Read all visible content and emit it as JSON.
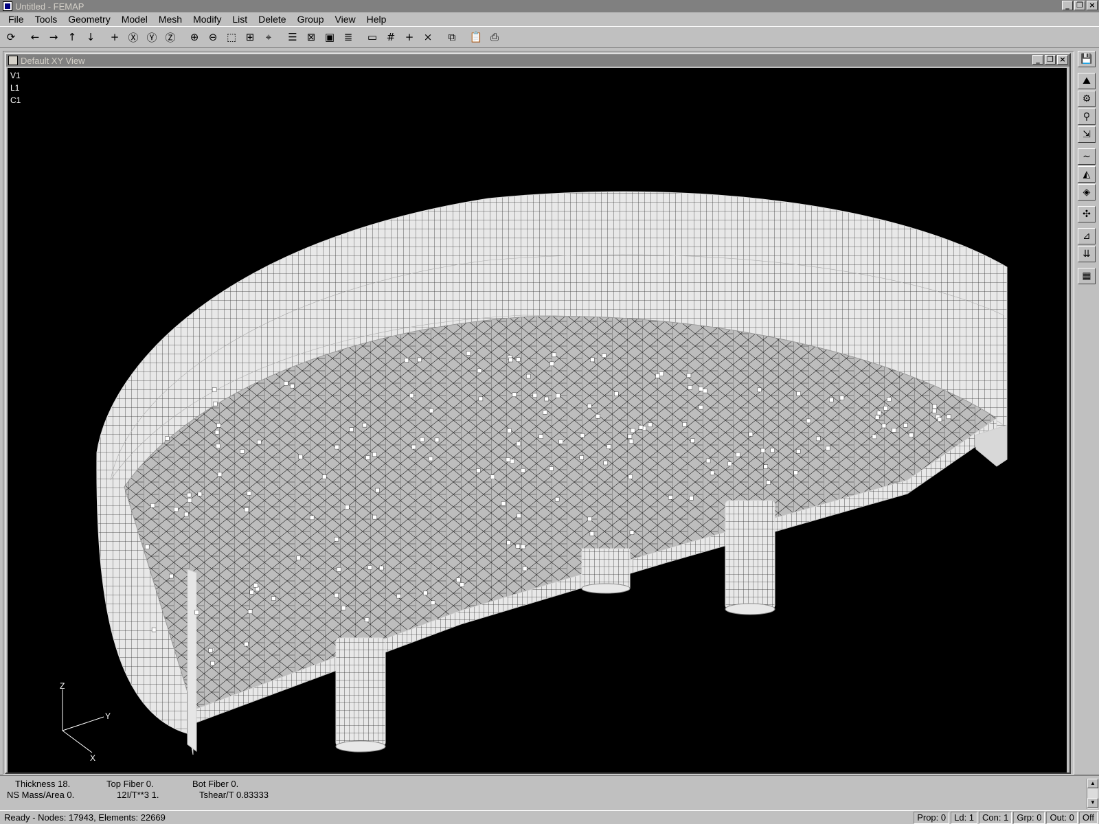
{
  "app": {
    "title": "Untitled - FEMAP",
    "icon": "femap-app-icon",
    "window_buttons": [
      "_",
      "❐",
      "×"
    ]
  },
  "menu": {
    "items": [
      {
        "label": "File",
        "underline": "F"
      },
      {
        "label": "Tools",
        "underline": "T"
      },
      {
        "label": "Geometry",
        "underline": "G"
      },
      {
        "label": "Model",
        "underline": "M"
      },
      {
        "label": "Mesh",
        "underline": "e"
      },
      {
        "label": "Modify",
        "underline": "o"
      },
      {
        "label": "List",
        "underline": "L"
      },
      {
        "label": "Delete",
        "underline": "D"
      },
      {
        "label": "Group",
        "underline": "G"
      },
      {
        "label": "View",
        "underline": "V"
      },
      {
        "label": "Help",
        "underline": "H"
      }
    ]
  },
  "toolbar": {
    "buttons": [
      {
        "name": "rotate-view-icon",
        "glyph": "⟳"
      },
      {
        "sep": true
      },
      {
        "name": "pan-left-icon",
        "glyph": "←"
      },
      {
        "name": "pan-right-icon",
        "glyph": "→"
      },
      {
        "name": "pan-up-icon",
        "glyph": "↑"
      },
      {
        "name": "pan-down-icon",
        "glyph": "↓"
      },
      {
        "sep": true
      },
      {
        "name": "center-icon",
        "glyph": "+"
      },
      {
        "name": "rotate-x-icon",
        "glyph": "Ⓧ"
      },
      {
        "name": "rotate-y-icon",
        "glyph": "Ⓨ"
      },
      {
        "name": "rotate-z-icon",
        "glyph": "Ⓩ"
      },
      {
        "sep": true
      },
      {
        "name": "zoom-in-icon",
        "glyph": "⊕"
      },
      {
        "name": "zoom-out-icon",
        "glyph": "⊖"
      },
      {
        "name": "zoom-window-icon",
        "glyph": "⬚"
      },
      {
        "name": "autoscale-icon",
        "glyph": "⊞"
      },
      {
        "name": "center-target-icon",
        "glyph": "⌖"
      },
      {
        "sep": true
      },
      {
        "name": "view-options-icon",
        "glyph": "☰"
      },
      {
        "name": "hidden-line-icon",
        "glyph": "⊠"
      },
      {
        "name": "solid-view-icon",
        "glyph": "▣"
      },
      {
        "name": "layers-icon",
        "glyph": "≣"
      },
      {
        "sep": true
      },
      {
        "name": "new-view-icon",
        "glyph": "▭"
      },
      {
        "name": "grid-icon",
        "glyph": "#"
      },
      {
        "name": "workplane-icon",
        "glyph": "+"
      },
      {
        "name": "delete-view-icon",
        "glyph": "×"
      },
      {
        "sep": true
      },
      {
        "name": "copy-picture-icon",
        "glyph": "⧉"
      },
      {
        "sep": true
      },
      {
        "name": "copy-clipboard-icon",
        "glyph": "📋"
      },
      {
        "name": "print-icon",
        "glyph": "⎙"
      }
    ]
  },
  "view_window": {
    "title": "Default XY View",
    "info_lines": [
      "V1",
      "L1",
      "C1"
    ],
    "axis_labels": {
      "z": "Z",
      "y": "Y",
      "x": "X"
    }
  },
  "right_toolbar": {
    "buttons": [
      {
        "name": "save-icon",
        "glyph": "💾"
      },
      {
        "gap": true
      },
      {
        "name": "geometry-tool-icon",
        "glyph": "⛰"
      },
      {
        "name": "mesh-tool-icon",
        "glyph": "⚙"
      },
      {
        "name": "constraint-tool-icon",
        "glyph": "⚲"
      },
      {
        "name": "load-tool-icon",
        "glyph": "⇲"
      },
      {
        "gap": true
      },
      {
        "name": "function-tool-icon",
        "glyph": "∼"
      },
      {
        "name": "surface-tool-icon",
        "glyph": "◭"
      },
      {
        "name": "solid-tool-icon",
        "glyph": "◈"
      },
      {
        "gap": true
      },
      {
        "name": "element-tool-icon",
        "glyph": "✣"
      },
      {
        "gap": true
      },
      {
        "name": "property-tool-icon",
        "glyph": "⊿"
      },
      {
        "name": "boundary-tool-icon",
        "glyph": "⇊"
      },
      {
        "gap": true
      },
      {
        "name": "output-tool-icon",
        "glyph": "▦"
      }
    ]
  },
  "property_panel": {
    "thickness": "Thickness 18.",
    "top_fiber": "Top Fiber 0.",
    "bot_fiber": "Bot Fiber 0.",
    "ns_mass": "NS Mass/Area 0.",
    "inertia_ratio": "12I/T**3 1.",
    "tshear": "Tshear/T 0.83333"
  },
  "status": {
    "message": "Ready - Nodes: 17943,  Elements: 22669",
    "panels": [
      "Prop: 0",
      "Ld: 1",
      "Con: 1",
      "Grp: 0",
      "Out: 0",
      "Off"
    ]
  },
  "colors": {
    "canvas_bg": "#000000",
    "mesh_fill": "#bdbdbd",
    "mesh_line": "#202020",
    "wall_fill": "#e6e6e6",
    "chrome": "#c0c0c0",
    "title_inactive": "#808080"
  }
}
